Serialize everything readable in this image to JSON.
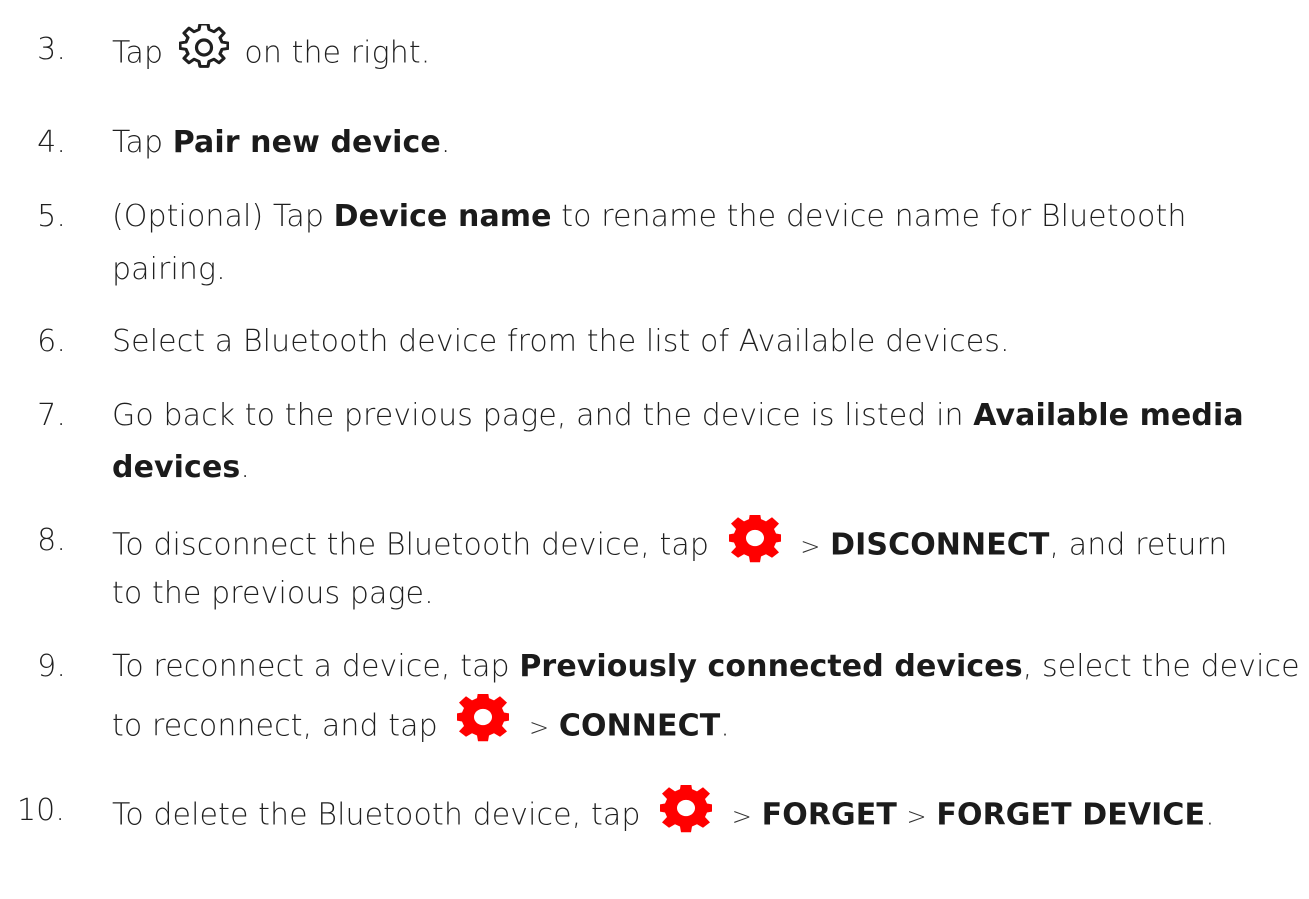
{
  "steps": [
    {
      "number": "3.",
      "parts": [
        "Tap",
        "on the right."
      ],
      "icon": "gear-outline-icon"
    },
    {
      "number": "4.",
      "parts": [
        "Tap",
        "Pair new device",
        "."
      ]
    },
    {
      "number": "5.",
      "parts": [
        "(Optional) Tap",
        "Device name",
        "to rename the device name for Bluetooth",
        "pairing."
      ]
    },
    {
      "number": "6.",
      "parts": [
        "Select a Bluetooth device from the list of Available devices."
      ]
    },
    {
      "number": "7.",
      "parts": [
        "Go back to the previous page, and the device is listed in",
        "Available media",
        "devices",
        "."
      ]
    },
    {
      "number": "8.",
      "parts": [
        "To disconnect the Bluetooth device, tap",
        ">",
        "DISCONNECT",
        ", and return",
        "to the previous page."
      ],
      "icon": "gear-red-icon"
    },
    {
      "number": "9.",
      "parts": [
        "To reconnect a device, tap",
        "Previously connected devices",
        ", select the device",
        "to reconnect, and tap",
        ">",
        "CONNECT",
        "."
      ],
      "icon": "gear-red-icon"
    },
    {
      "number": "10.",
      "parts": [
        "To delete the Bluetooth device, tap",
        ">",
        "FORGET",
        ">",
        "FORGET DEVICE",
        "."
      ],
      "icon": "gear-red-icon"
    }
  ],
  "colors": {
    "text": "#1f1f1f",
    "gear_red": "#ff0000"
  }
}
